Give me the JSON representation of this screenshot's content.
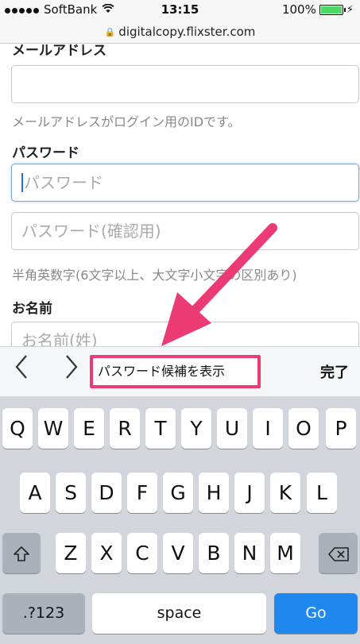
{
  "status_bar": {
    "carrier": "SoftBank",
    "time": "13:15",
    "battery": "100%",
    "battery_level": 1.0
  },
  "url_bar": {
    "url": "digitalcopy.flixster.com"
  },
  "form": {
    "email_label": "メールアドレス",
    "email_value": "",
    "email_hint": "メールアドレスがログイン用のIDです。",
    "password_label": "パスワード",
    "password_placeholder": "パスワード",
    "password_confirm_placeholder": "パスワード(確認用)",
    "password_hint": "半角英数字(6文字以上、大文字小文字の区別あり)",
    "name_label": "お名前",
    "last_name_placeholder": "お名前(姓)"
  },
  "accessory_bar": {
    "prev_icon": "chevron-left-icon",
    "next_icon": "chevron-right-icon",
    "suggest_password": "パスワード候補を表示",
    "done": "完了",
    "highlight_color": "#ec3b74"
  },
  "keyboard": {
    "row1": [
      "Q",
      "W",
      "E",
      "R",
      "T",
      "Y",
      "U",
      "I",
      "O",
      "P"
    ],
    "row2": [
      "A",
      "S",
      "D",
      "F",
      "G",
      "H",
      "J",
      "K",
      "L"
    ],
    "row3": [
      "Z",
      "X",
      "C",
      "V",
      "B",
      "N",
      "M"
    ],
    "numbers": ".?123",
    "space": "space",
    "go": "Go",
    "go_color": "#1e88ef"
  }
}
